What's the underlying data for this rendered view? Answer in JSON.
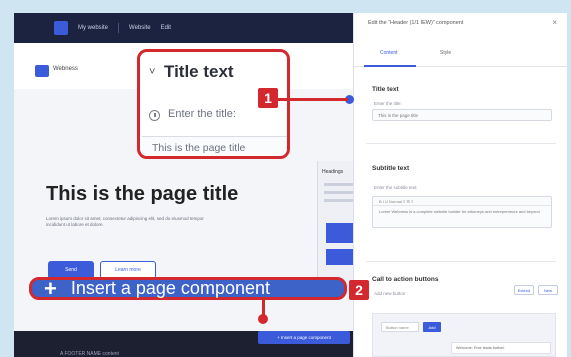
{
  "topbar": {
    "site_label": "My website",
    "menu_label": "Website",
    "extra_label": "Edit"
  },
  "site": {
    "name": "Webness"
  },
  "page": {
    "title": "This is the page title",
    "intro": "Lorem ipsum dolor sit amet, consectetur adipiscing elit, sed do eiusmod tempor incididunt ut labore et dolore.",
    "primary_button": "Send",
    "secondary_button": "Learn more"
  },
  "mid_panel": {
    "heading": "Headings"
  },
  "insert_small_label": "+ Insert a page component",
  "footer_text": "A FOOTER NAME content",
  "edit_panel": {
    "title": "Edit the “Header (1/1 IEW)” component",
    "close": "×",
    "tabs": [
      {
        "label": "Content"
      },
      {
        "label": "Style"
      }
    ],
    "title_section": {
      "heading": "Title text",
      "label": "Enter the title:",
      "value": "This is the page title"
    },
    "subtitle_section": {
      "heading": "Subtitle text",
      "label": "Enter the subtitle text:",
      "toolbar": "B  I  U   Normal    ≡  ☰  ≡",
      "value": "Lorem Webness is a complete website builder for attorneys and entrepreneurs and beyond"
    },
    "cta_section": {
      "heading": "Call to action buttons",
      "hint": "Add new button",
      "btn_a": "Extend",
      "btn_b": "New",
      "input": "Button name",
      "go": "Add",
      "note": "Welcome: Free leads button!"
    }
  },
  "callout1": {
    "badge": "1",
    "title": "Title text",
    "chevron": "˅",
    "label": "Enter the title:",
    "value": "This is the page title"
  },
  "callout2": {
    "badge": "2",
    "plus": "+",
    "text": "Insert a page component"
  },
  "colors": {
    "accent": "#3b5bdb",
    "callout_red": "#d4282f",
    "topbar": "#1c2340"
  }
}
